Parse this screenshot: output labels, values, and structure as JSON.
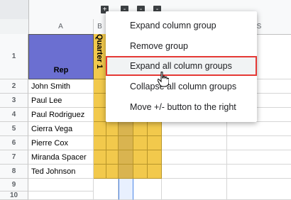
{
  "group_buttons": [
    "+",
    "-",
    "-",
    "-"
  ],
  "columns": [
    "A",
    "B",
    "S"
  ],
  "header_cell": "Rep",
  "quarter_label": "Quarter 1",
  "rows": [
    {
      "num": "1",
      "name": ""
    },
    {
      "num": "2",
      "name": "John Smith"
    },
    {
      "num": "3",
      "name": "Paul Lee"
    },
    {
      "num": "4",
      "name": "Paul Rodriguez"
    },
    {
      "num": "5",
      "name": "Cierra Vega"
    },
    {
      "num": "6",
      "name": "Pierre Cox"
    },
    {
      "num": "7",
      "name": "Miranda Spacer"
    },
    {
      "num": "8",
      "name": "Ted Johnson"
    },
    {
      "num": "9",
      "name": ""
    },
    {
      "num": "10",
      "name": ""
    }
  ],
  "menu": {
    "items": [
      "Expand column group",
      "Remove group",
      "Expand all column groups",
      "Collapse all column groups",
      "Move +/- button to the right"
    ],
    "highlighted_index": 2
  },
  "colors": {
    "rep_header": "#6b6fd1",
    "quarter_fill": "#f2c94c",
    "highlight_border": "#e53935"
  }
}
